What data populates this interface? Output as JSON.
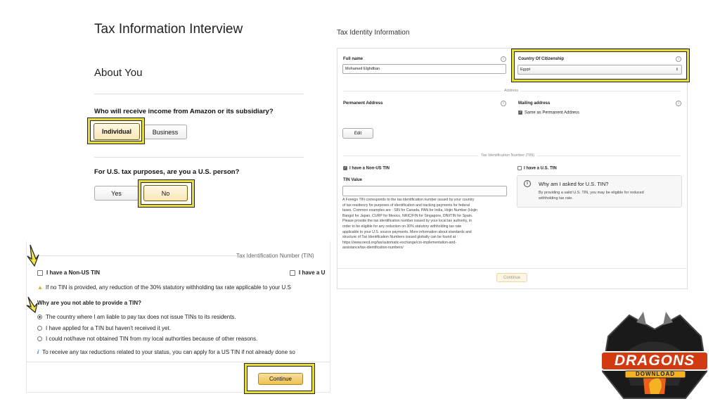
{
  "main": {
    "title": "Tax Information Interview",
    "section": "About You",
    "q1": "Who will receive income from Amazon or its subsidiary?",
    "q1_options": [
      "Individual",
      "Business"
    ],
    "q1_selected": "Individual",
    "q2": "For U.S. tax purposes, are you a U.S. person?",
    "q2_options": [
      "Yes",
      "No"
    ],
    "q2_selected": "No"
  },
  "tax_identity": {
    "title": "Tax Identity Information",
    "full_name_label": "Full name",
    "full_name_value": "Mohamed Elghdban",
    "citizenship_label": "Country Of Citizenship",
    "citizenship_value": "Egypt",
    "address_divider": "Address",
    "permanent_address_label": "Permanent Address",
    "mailing_address_label": "Mailing address",
    "same_as_permanent": "Same as Permanent Address",
    "edit_label": "Edit",
    "tin_divider": "Tax Identification Number (TIN)",
    "non_us_tin_label": "I have a Non-US TIN",
    "us_tin_label": "I have a U.S. TIN",
    "tin_value_label": "TIN Value",
    "tin_help": [
      "A Foreign TIN corresponds to the tax identification number issued by your country",
      "of tax residency for purposes of identification and tracking payments for federal",
      "taxes. Common examples are : SIN for Canada, PAN for India, Hojin Number (Hojin",
      "Bangol for Japan, CURP for Mexico, NRIC/FIN for Singapore, DNI/TIN for Spain.",
      "Please provide the tax identification number issued by your local tax authority, in",
      "order to be eligible for any reduction on 30% statutory withholding tax rate",
      "applicable to your U.S. source payments. More information about standards and",
      "structure of Tax Identification Numbers issued globally can be found at :",
      "https://www.oecd.org/tax/automatic-exchange/crs-implementation-and-",
      "assistance/tax-identification-numbers/"
    ],
    "why_title": "Why am I asked for U.S. TIN?",
    "why_body": [
      "By providing a valid U.S. TIN, you may be eligible for reduced",
      "withholding tax rate."
    ],
    "continue_label": "Continue"
  },
  "tin_panel": {
    "divider": "Tax Identification Number (TIN)",
    "non_us_tin": "I have a Non-US TIN",
    "us_tin_partial": "I have a U",
    "warning": "If no TIN is provided, any reduction of the 30% statutory withholding tax rate applicable to your U.S",
    "why_question": "Why are you not able to provide a TIN?",
    "reasons": [
      "The country where I am liable to pay tax does not issue TINs to its residents.",
      "I have applied for a TIN but haven't received it yet.",
      "I could not/have not obtained TIN from my local authorities because of other reasons."
    ],
    "selected_reason": 0,
    "info_note": "To receive any tax reductions related to your status, you can apply for a US TIN if not already done so",
    "continue_label": "Continue"
  },
  "logo": {
    "top_text": "DRAGONS",
    "bottom_text": "DOWNLOAD"
  },
  "colors": {
    "highlight": "#e6dc3a",
    "primary_button": "#f0c14b",
    "warning": "#e8a317",
    "info": "#2f7db6"
  }
}
